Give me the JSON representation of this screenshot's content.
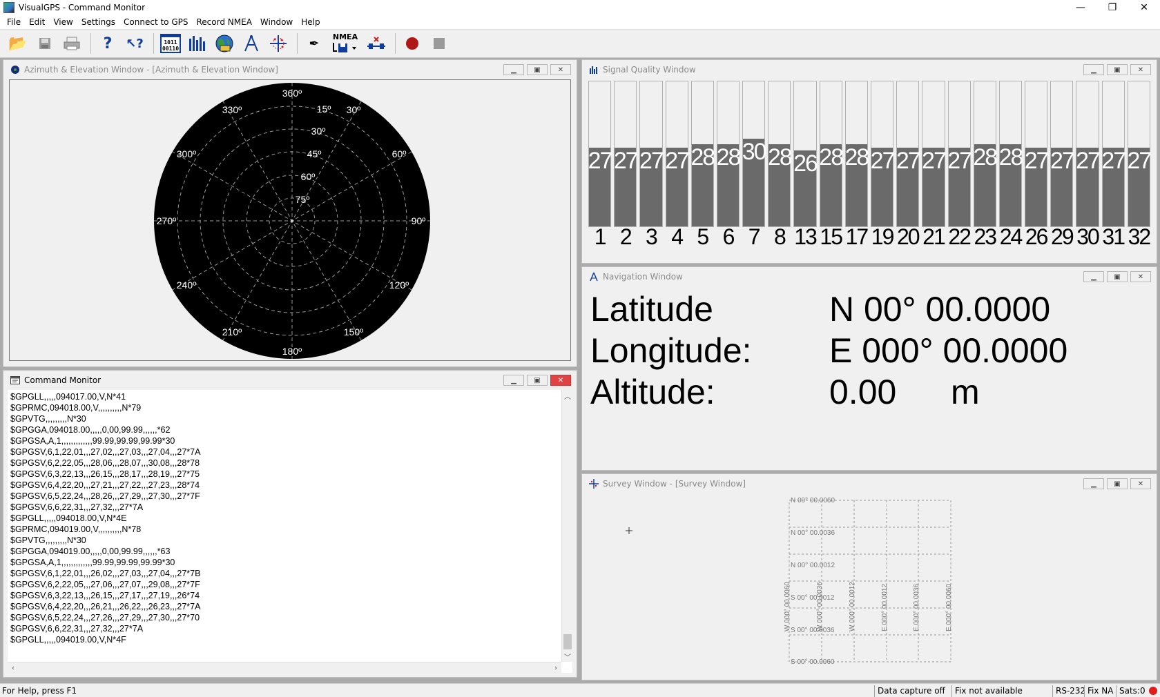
{
  "window": {
    "title": "VisualGPS - Command Monitor",
    "minimize": "—",
    "maximize": "❐",
    "close": "✕"
  },
  "menu": [
    "File",
    "Edit",
    "View",
    "Settings",
    "Connect to GPS",
    "Record NMEA",
    "Window",
    "Help"
  ],
  "toolbar": {
    "nmea_label": "NMEA",
    "bits_label": "1 0 1 1\n0 0 1 1 0"
  },
  "azel": {
    "title": "Azimuth & Elevation Window - [Azimuth & Elevation Window]",
    "azimuth_labels": {
      "n": "360º",
      "e": "90º",
      "s": "180º",
      "w": "270º",
      "a30": "30º",
      "a60": "60º",
      "a120": "120º",
      "a150": "150º",
      "a210": "210º",
      "a240": "240º",
      "a300": "300º",
      "a330": "330º"
    },
    "elevation_labels": [
      "15º",
      "30º",
      "45º",
      "60º",
      "75º"
    ]
  },
  "signal": {
    "title": "Signal Quality Window",
    "satellites": [
      {
        "id": "1",
        "snr": 27
      },
      {
        "id": "2",
        "snr": 27
      },
      {
        "id": "3",
        "snr": 27
      },
      {
        "id": "4",
        "snr": 27
      },
      {
        "id": "5",
        "snr": 28
      },
      {
        "id": "6",
        "snr": 28
      },
      {
        "id": "7",
        "snr": 30
      },
      {
        "id": "8",
        "snr": 28
      },
      {
        "id": "13",
        "snr": 26
      },
      {
        "id": "15",
        "snr": 28
      },
      {
        "id": "17",
        "snr": 28
      },
      {
        "id": "19",
        "snr": 27
      },
      {
        "id": "20",
        "snr": 27
      },
      {
        "id": "21",
        "snr": 27
      },
      {
        "id": "22",
        "snr": 27
      },
      {
        "id": "23",
        "snr": 28
      },
      {
        "id": "24",
        "snr": 28
      },
      {
        "id": "26",
        "snr": 27
      },
      {
        "id": "29",
        "snr": 27
      },
      {
        "id": "30",
        "snr": 27
      },
      {
        "id": "31",
        "snr": 27
      },
      {
        "id": "32",
        "snr": 27
      }
    ]
  },
  "navigation": {
    "title": "Navigation Window",
    "latitude_label": "Latitude",
    "latitude_value": "N 00° 00.0000",
    "longitude_label": "Longitude:",
    "longitude_value": "E 000° 00.0000",
    "altitude_label": "Altitude:",
    "altitude_value": "0.00",
    "altitude_unit": "m"
  },
  "survey": {
    "title": "Survey Window - [Survey Window]",
    "lat_labels": [
      "N 00° 00.0060",
      "N 00° 00.0036",
      "N 00° 00.0012",
      "S 00° 00.0012",
      "S 00° 00.0036",
      "S 00° 00.0060"
    ],
    "lon_labels": [
      "W 000° 00.0060",
      "W 000° 00.0036",
      "W 000° 00.0012",
      "E 000° 00.0012",
      "E 000° 00.0036",
      "E 000° 00.0060"
    ]
  },
  "command_monitor": {
    "title": "Command Monitor",
    "lines": [
      "$GPGLL,,,,,094017.00,V,N*41",
      "$GPRMC,094018.00,V,,,,,,,,,,N*79",
      "$GPVTG,,,,,,,,,N*30",
      "$GPGGA,094018.00,,,,,0,00,99.99,,,,,,*62",
      "$GPGSA,A,1,,,,,,,,,,,,,99.99,99.99,99.99*30",
      "$GPGSV,6,1,22,01,,,27,02,,,27,03,,,27,04,,,27*7A",
      "$GPGSV,6,2,22,05,,,28,06,,,28,07,,,30,08,,,28*78",
      "$GPGSV,6,3,22,13,,,26,15,,,28,17,,,28,19,,,27*75",
      "$GPGSV,6,4,22,20,,,27,21,,,27,22,,,27,23,,,28*74",
      "$GPGSV,6,5,22,24,,,28,26,,,27,29,,,27,30,,,27*7F",
      "$GPGSV,6,6,22,31,,,27,32,,,27*7A",
      "$GPGLL,,,,,094018.00,V,N*4E",
      "$GPRMC,094019.00,V,,,,,,,,,,N*78",
      "$GPVTG,,,,,,,,,N*30",
      "$GPGGA,094019.00,,,,,0,00,99.99,,,,,,*63",
      "$GPGSA,A,1,,,,,,,,,,,,,99.99,99.99,99.99*30",
      "$GPGSV,6,1,22,01,,,26,02,,,27,03,,,27,04,,,27*7B",
      "$GPGSV,6,2,22,05,,,27,06,,,27,07,,,29,08,,,27*7F",
      "$GPGSV,6,3,22,13,,,26,15,,,27,17,,,27,19,,,26*74",
      "$GPGSV,6,4,22,20,,,26,21,,,26,22,,,26,23,,,27*7A",
      "$GPGSV,6,5,22,24,,,27,26,,,27,29,,,27,30,,,27*70",
      "$GPGSV,6,6,22,31,,,27,32,,,27*7A",
      "$GPGLL,,,,,094019.00,V,N*4F"
    ]
  },
  "statusbar": {
    "help": "For Help, press F1",
    "capture": "Data capture off",
    "fix": "Fix not available",
    "port": "RS-232",
    "fix_short": "Fix NA",
    "sats": "Sats:0"
  },
  "colors": {
    "signal_bar": "#6a6a6a",
    "polar_bg": "#000000",
    "status_led": "#e01c1c"
  }
}
